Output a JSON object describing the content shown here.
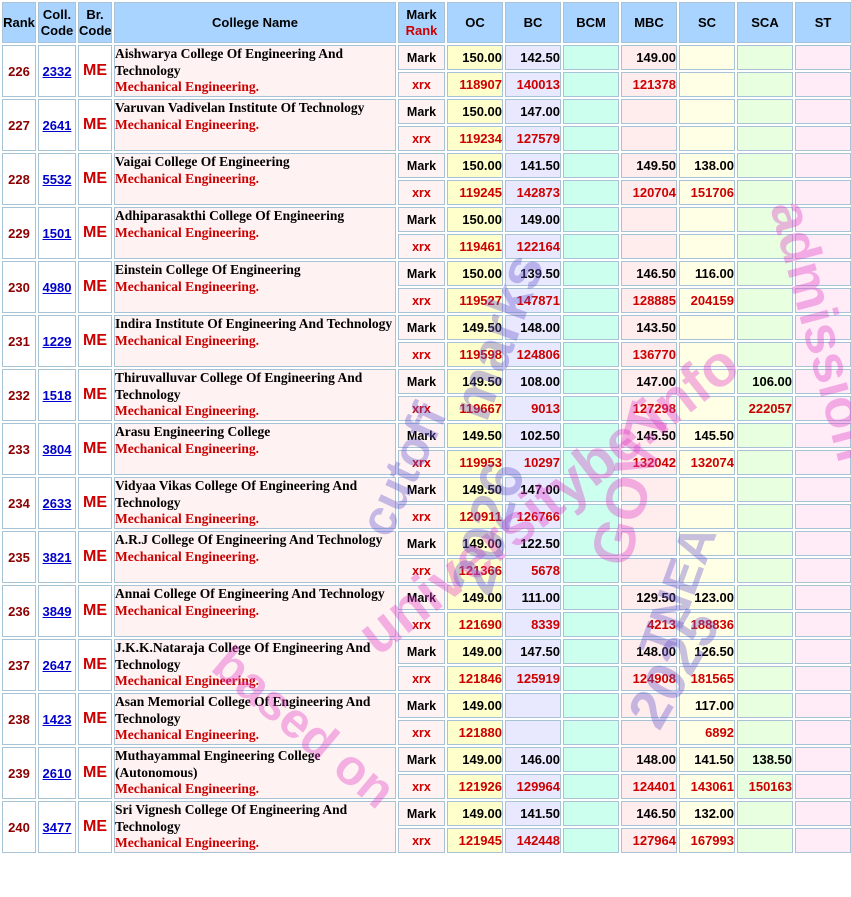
{
  "headers": {
    "rank": "Rank",
    "coll_code": "Coll. Code",
    "br_code": "Br. Code",
    "college_name": "College Name",
    "mark": "Mark",
    "rank2": "Rank",
    "oc": "OC",
    "bc": "BC",
    "bcm": "BCM",
    "mbc": "MBC",
    "sc": "SC",
    "sca": "SCA",
    "st": "ST"
  },
  "labels": {
    "mark": "Mark",
    "rank": "xrx"
  },
  "watermark": {
    "line1": "universitybe.info",
    "line2": "marks",
    "line3": "cutoff",
    "line4": "2026",
    "line5": "GOVT",
    "line6": "TNEA",
    "line7": "2025",
    "line8": "based on",
    "line9": "admission"
  },
  "rows": [
    {
      "rank": "226",
      "code": "2332",
      "br": "ME",
      "name": "Aishwarya College Of Engineering And Technology",
      "branch": "Mechanical Engineering.",
      "marks": {
        "oc": "150.00",
        "bc": "142.50",
        "bcm": "",
        "mbc": "149.00",
        "sc": "",
        "sca": "",
        "st": ""
      },
      "ranks": {
        "oc": "118907",
        "bc": "140013",
        "bcm": "",
        "mbc": "121378",
        "sc": "",
        "sca": "",
        "st": ""
      }
    },
    {
      "rank": "227",
      "code": "2641",
      "br": "ME",
      "name": "Varuvan Vadivelan Institute Of Technology",
      "branch": "Mechanical Engineering.",
      "marks": {
        "oc": "150.00",
        "bc": "147.00",
        "bcm": "",
        "mbc": "",
        "sc": "",
        "sca": "",
        "st": ""
      },
      "ranks": {
        "oc": "119234",
        "bc": "127579",
        "bcm": "",
        "mbc": "",
        "sc": "",
        "sca": "",
        "st": ""
      }
    },
    {
      "rank": "228",
      "code": "5532",
      "br": "ME",
      "name": "Vaigai College Of Engineering",
      "branch": "Mechanical Engineering.",
      "marks": {
        "oc": "150.00",
        "bc": "141.50",
        "bcm": "",
        "mbc": "149.50",
        "sc": "138.00",
        "sca": "",
        "st": ""
      },
      "ranks": {
        "oc": "119245",
        "bc": "142873",
        "bcm": "",
        "mbc": "120704",
        "sc": "151706",
        "sca": "",
        "st": ""
      }
    },
    {
      "rank": "229",
      "code": "1501",
      "br": "ME",
      "name": "Adhiparasakthi College Of Engineering",
      "branch": "Mechanical Engineering.",
      "marks": {
        "oc": "150.00",
        "bc": "149.00",
        "bcm": "",
        "mbc": "",
        "sc": "",
        "sca": "",
        "st": ""
      },
      "ranks": {
        "oc": "119461",
        "bc": "122164",
        "bcm": "",
        "mbc": "",
        "sc": "",
        "sca": "",
        "st": ""
      }
    },
    {
      "rank": "230",
      "code": "4980",
      "br": "ME",
      "name": "Einstein College Of Engineering",
      "branch": "Mechanical Engineering.",
      "marks": {
        "oc": "150.00",
        "bc": "139.50",
        "bcm": "",
        "mbc": "146.50",
        "sc": "116.00",
        "sca": "",
        "st": ""
      },
      "ranks": {
        "oc": "119527",
        "bc": "147871",
        "bcm": "",
        "mbc": "128885",
        "sc": "204159",
        "sca": "",
        "st": ""
      }
    },
    {
      "rank": "231",
      "code": "1229",
      "br": "ME",
      "name": "Indira Institute Of Engineering And Technology",
      "branch": "Mechanical Engineering.",
      "marks": {
        "oc": "149.50",
        "bc": "148.00",
        "bcm": "",
        "mbc": "143.50",
        "sc": "",
        "sca": "",
        "st": ""
      },
      "ranks": {
        "oc": "119598",
        "bc": "124806",
        "bcm": "",
        "mbc": "136770",
        "sc": "",
        "sca": "",
        "st": ""
      }
    },
    {
      "rank": "232",
      "code": "1518",
      "br": "ME",
      "name": "Thiruvalluvar College Of Engineering And Technology",
      "branch": "Mechanical Engineering.",
      "marks": {
        "oc": "149.50",
        "bc": "108.00",
        "bcm": "",
        "mbc": "147.00",
        "sc": "",
        "sca": "106.00",
        "st": ""
      },
      "ranks": {
        "oc": "119667",
        "bc": "9013",
        "bcm": "",
        "mbc": "127298",
        "sc": "",
        "sca": "222057",
        "st": ""
      }
    },
    {
      "rank": "233",
      "code": "3804",
      "br": "ME",
      "name": "Arasu Engineering College",
      "branch": "Mechanical Engineering.",
      "marks": {
        "oc": "149.50",
        "bc": "102.50",
        "bcm": "",
        "mbc": "145.50",
        "sc": "145.50",
        "sca": "",
        "st": ""
      },
      "ranks": {
        "oc": "119953",
        "bc": "10297",
        "bcm": "",
        "mbc": "132042",
        "sc": "132074",
        "sca": "",
        "st": ""
      }
    },
    {
      "rank": "234",
      "code": "2633",
      "br": "ME",
      "name": "Vidyaa Vikas College Of Engineering And Technology",
      "branch": "Mechanical Engineering.",
      "marks": {
        "oc": "149.50",
        "bc": "147.00",
        "bcm": "",
        "mbc": "",
        "sc": "",
        "sca": "",
        "st": ""
      },
      "ranks": {
        "oc": "120911",
        "bc": "126766",
        "bcm": "",
        "mbc": "",
        "sc": "",
        "sca": "",
        "st": ""
      }
    },
    {
      "rank": "235",
      "code": "3821",
      "br": "ME",
      "name": "A.R.J College Of Engineering And Technology",
      "branch": "Mechanical Engineering.",
      "marks": {
        "oc": "149.00",
        "bc": "122.50",
        "bcm": "",
        "mbc": "",
        "sc": "",
        "sca": "",
        "st": ""
      },
      "ranks": {
        "oc": "121366",
        "bc": "5678",
        "bcm": "",
        "mbc": "",
        "sc": "",
        "sca": "",
        "st": ""
      }
    },
    {
      "rank": "236",
      "code": "3849",
      "br": "ME",
      "name": "Annai College Of Engineering And Technology",
      "branch": "Mechanical Engineering.",
      "marks": {
        "oc": "149.00",
        "bc": "111.00",
        "bcm": "",
        "mbc": "129.50",
        "sc": "123.00",
        "sca": "",
        "st": ""
      },
      "ranks": {
        "oc": "121690",
        "bc": "8339",
        "bcm": "",
        "mbc": "4213",
        "sc": "188836",
        "sca": "",
        "st": ""
      }
    },
    {
      "rank": "237",
      "code": "2647",
      "br": "ME",
      "name": "J.K.K.Nataraja College Of Engineering And Technology",
      "branch": "Mechanical Engineering.",
      "marks": {
        "oc": "149.00",
        "bc": "147.50",
        "bcm": "",
        "mbc": "148.00",
        "sc": "126.50",
        "sca": "",
        "st": ""
      },
      "ranks": {
        "oc": "121846",
        "bc": "125919",
        "bcm": "",
        "mbc": "124908",
        "sc": "181565",
        "sca": "",
        "st": ""
      }
    },
    {
      "rank": "238",
      "code": "1423",
      "br": "ME",
      "name": "Asan Memorial College Of Engineering And Technology",
      "branch": "Mechanical Engineering.",
      "marks": {
        "oc": "149.00",
        "bc": "",
        "bcm": "",
        "mbc": "",
        "sc": "117.00",
        "sca": "",
        "st": ""
      },
      "ranks": {
        "oc": "121880",
        "bc": "",
        "bcm": "",
        "mbc": "",
        "sc": "6892",
        "sca": "",
        "st": ""
      }
    },
    {
      "rank": "239",
      "code": "2610",
      "br": "ME",
      "name": "Muthayammal Engineering College (Autonomous)",
      "branch": "Mechanical Engineering.",
      "marks": {
        "oc": "149.00",
        "bc": "146.00",
        "bcm": "",
        "mbc": "148.00",
        "sc": "141.50",
        "sca": "138.50",
        "st": ""
      },
      "ranks": {
        "oc": "121926",
        "bc": "129964",
        "bcm": "",
        "mbc": "124401",
        "sc": "143061",
        "sca": "150163",
        "st": ""
      }
    },
    {
      "rank": "240",
      "code": "3477",
      "br": "ME",
      "name": "Sri Vignesh College Of Engineering And Technology",
      "branch": "Mechanical Engineering.",
      "marks": {
        "oc": "149.00",
        "bc": "141.50",
        "bcm": "",
        "mbc": "146.50",
        "sc": "132.00",
        "sca": "",
        "st": ""
      },
      "ranks": {
        "oc": "121945",
        "bc": "142448",
        "bcm": "",
        "mbc": "127964",
        "sc": "167993",
        "sca": "",
        "st": ""
      }
    }
  ]
}
